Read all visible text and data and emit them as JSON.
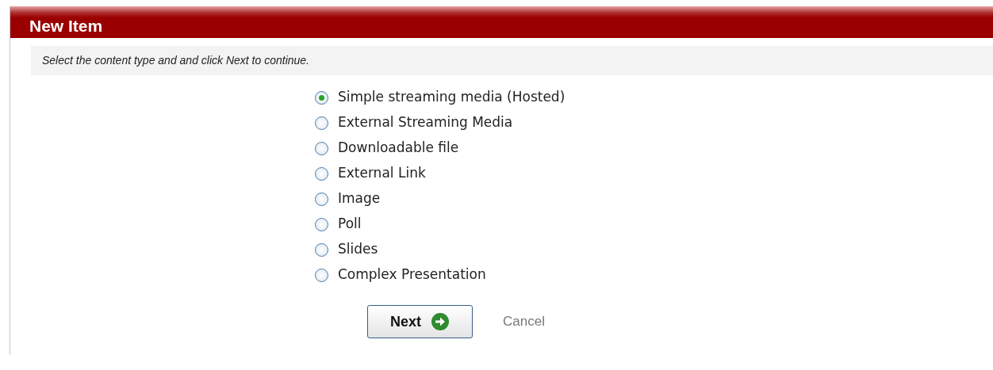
{
  "header": {
    "title": "New Item"
  },
  "instruction": "Select the content type and and click Next to continue.",
  "options": [
    {
      "label": "Simple streaming media (Hosted)",
      "selected": true
    },
    {
      "label": "External Streaming Media",
      "selected": false
    },
    {
      "label": "Downloadable file",
      "selected": false
    },
    {
      "label": "External Link",
      "selected": false
    },
    {
      "label": "Image",
      "selected": false
    },
    {
      "label": "Poll",
      "selected": false
    },
    {
      "label": "Slides",
      "selected": false
    },
    {
      "label": "Complex Presentation",
      "selected": false
    }
  ],
  "buttons": {
    "next": "Next",
    "cancel": "Cancel"
  }
}
